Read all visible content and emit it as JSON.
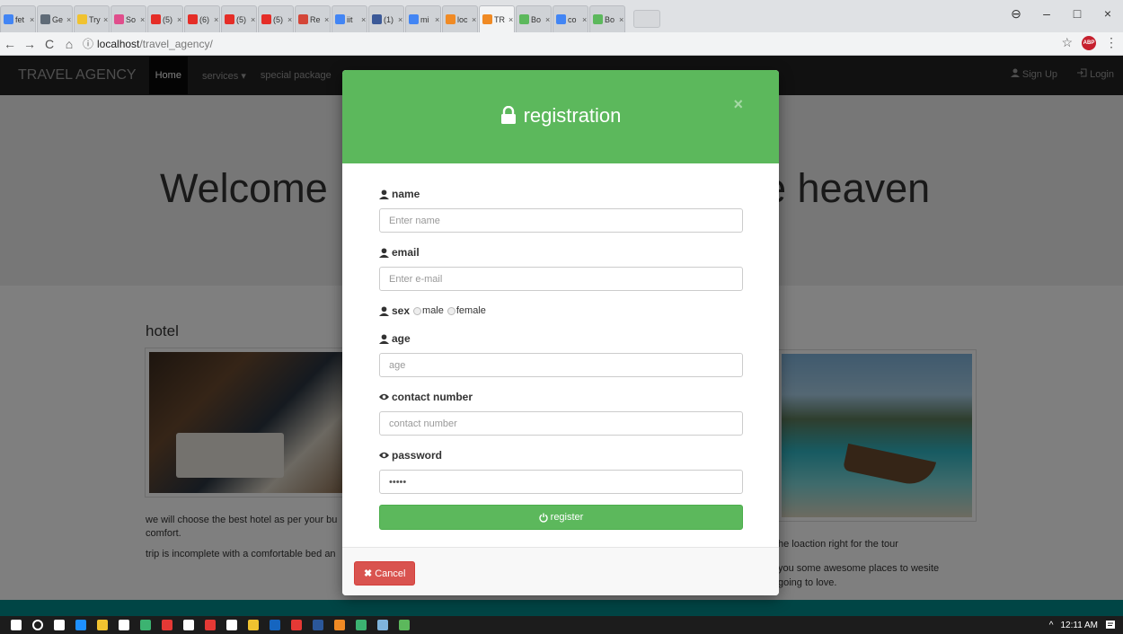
{
  "browser": {
    "tabs": [
      {
        "title": "fet",
        "fav_color": "#4285f4",
        "active": false
      },
      {
        "title": "Ge",
        "fav_color": "#5f6b77",
        "active": false
      },
      {
        "title": "Try",
        "fav_color": "#f0c230",
        "active": false
      },
      {
        "title": "So",
        "fav_color": "#e04e8c",
        "active": false
      },
      {
        "title": "(5)",
        "fav_color": "#e52d27",
        "active": false
      },
      {
        "title": "(6)",
        "fav_color": "#e52d27",
        "active": false
      },
      {
        "title": "(5)",
        "fav_color": "#e52d27",
        "active": false
      },
      {
        "title": "(5)",
        "fav_color": "#e52d27",
        "active": false
      },
      {
        "title": "Re",
        "fav_color": "#d44638",
        "active": false
      },
      {
        "title": "iit",
        "fav_color": "#4285f4",
        "active": false
      },
      {
        "title": "(1)",
        "fav_color": "#3b5998",
        "active": false
      },
      {
        "title": "mi",
        "fav_color": "#4285f4",
        "active": false
      },
      {
        "title": "loc",
        "fav_color": "#f08a24",
        "active": false
      },
      {
        "title": "TR",
        "fav_color": "#f08a24",
        "active": true
      },
      {
        "title": "Bo",
        "fav_color": "#5cb85c",
        "active": false
      },
      {
        "title": "co",
        "fav_color": "#4285f4",
        "active": false
      },
      {
        "title": "Bo",
        "fav_color": "#5cb85c",
        "active": false
      }
    ],
    "tab_close": "×",
    "window_controls": {
      "profile": "⊖",
      "minimize": "–",
      "maximize": "□",
      "close": "×"
    },
    "nav": {
      "back": "←",
      "forward": "→",
      "reload": "C",
      "home": "⌂"
    },
    "url_info_icon": "ⓘ",
    "url_host": "localhost",
    "url_path": "/travel_agency/",
    "bookmark": "☆",
    "abp_label": "ABP",
    "menu": "⋮"
  },
  "site": {
    "brand": "TRAVEL AGENCY",
    "nav": {
      "home": "Home",
      "services": "services ▾",
      "special": "special package"
    },
    "signup": "Sign Up",
    "login": "Login",
    "jumbo_left": "Welcome",
    "jumbo_right": "e heaven",
    "hotel_title": "hotel",
    "hotel_p1": "we will choose the best hotel as per your bu comfort.",
    "hotel_p2": "trip is incomplete with a comfortable bed an",
    "beach_p1": "he loaction right for the tour",
    "beach_p2": "you some awesome places to wesite going to love."
  },
  "modal": {
    "title": "registration",
    "close": "×",
    "fields": {
      "name": {
        "label": "name",
        "placeholder": "Enter name"
      },
      "email": {
        "label": "email",
        "placeholder": "Enter e-mail"
      },
      "sex": {
        "label": "sex",
        "options": [
          "male",
          "female"
        ]
      },
      "age": {
        "label": "age",
        "placeholder": "age"
      },
      "contact": {
        "label": "contact number",
        "placeholder": "contact number"
      },
      "password": {
        "label": "password",
        "value": "•••••"
      }
    },
    "register": "register",
    "cancel": "Cancel",
    "cancel_icon": "✖"
  },
  "taskbar": {
    "icons": [
      "#ffffff",
      "#ffffff",
      "#ffffff",
      "#1e90ff",
      "#f0c230",
      "#ffffff",
      "#3cb371",
      "#e53935",
      "#ffffff",
      "#e53935",
      "#ffffff",
      "#f0c230",
      "#1565c0",
      "#e53935",
      "#2b579a",
      "#f08a24",
      "#3cb371",
      "#7fb4dc",
      "#5cb85c"
    ],
    "tray_arrow": "^",
    "time": "12:11 AM"
  },
  "colors": {
    "success": "#5cb85c",
    "danger": "#d9534f",
    "navbar": "#222222"
  }
}
